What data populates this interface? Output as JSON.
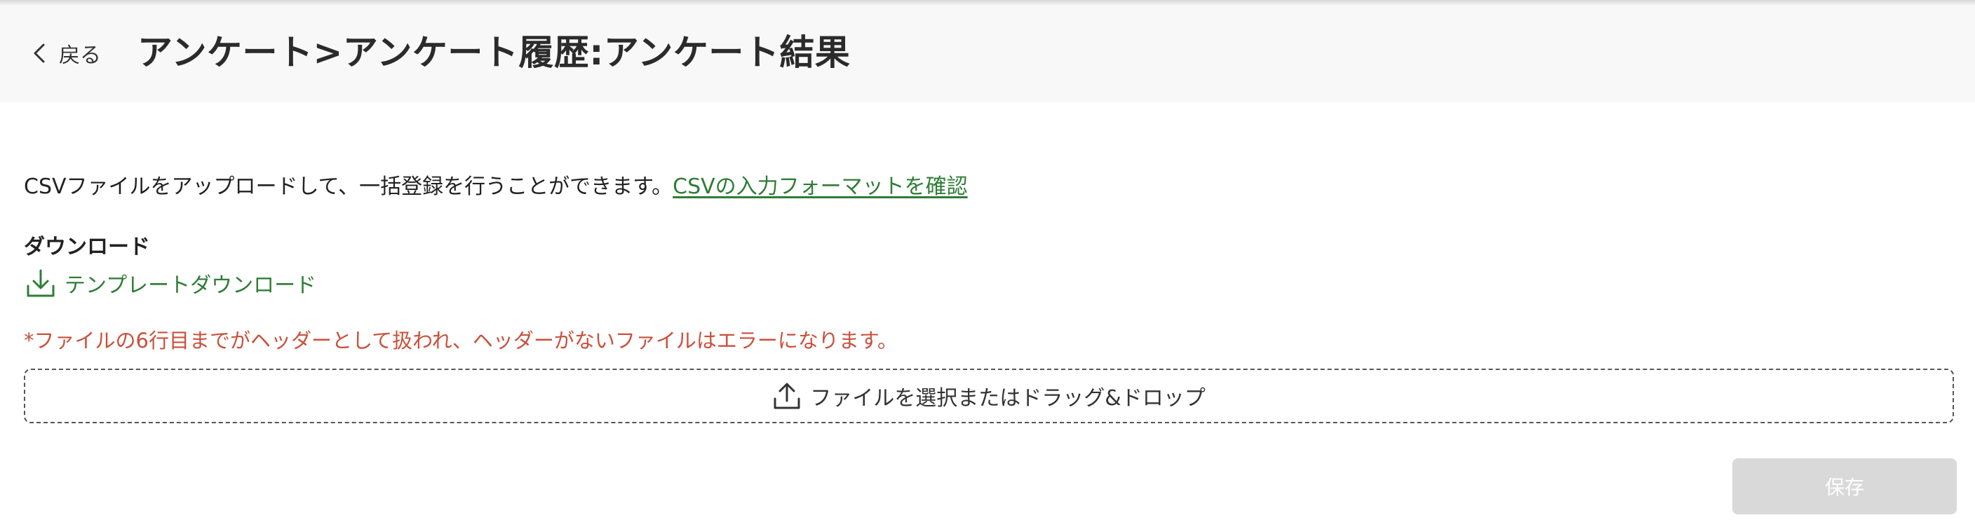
{
  "header": {
    "back_label": "戻る",
    "title": "アンケート>アンケート履歴:アンケート結果"
  },
  "intro": {
    "text": "CSVファイルをアップロードして、一括登録を行うことができます。",
    "link": "CSVの入力フォーマットを確認"
  },
  "download": {
    "section_label": "ダウンロード",
    "template_label": "テンプレートダウンロード"
  },
  "warning": "*ファイルの6行目までがヘッダーとして扱われ、ヘッダーがないファイルはエラーになります。",
  "dropzone": {
    "label": "ファイルを選択またはドラッグ&ドロップ"
  },
  "actions": {
    "save_label": "保存",
    "save_enabled": false
  },
  "colors": {
    "accent": "#2f7d36",
    "warning": "#c9513c",
    "header_bg": "#f7f8f7",
    "disabled_button": "#d9d9d9"
  },
  "icons": {
    "back": "chevron-left-icon",
    "download": "download-icon",
    "upload": "upload-icon"
  }
}
